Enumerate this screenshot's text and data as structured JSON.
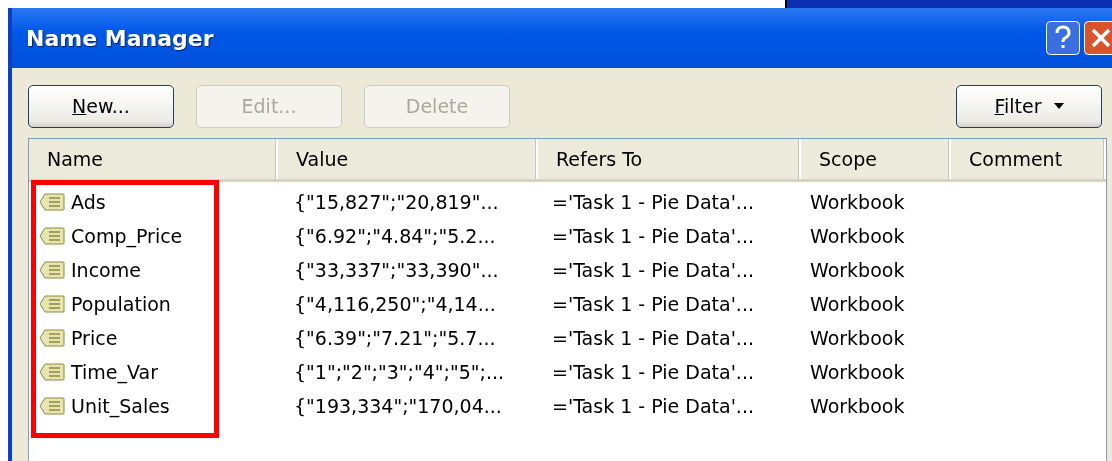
{
  "window": {
    "title": "Name Manager"
  },
  "buttons": [
    {
      "label": "New...",
      "disabled": false,
      "underline_first": true
    },
    {
      "label": "Edit...",
      "disabled": true,
      "underline_first": false
    },
    {
      "label": "Delete",
      "disabled": true,
      "underline_first": false
    }
  ],
  "filter_button": {
    "label": "Filter",
    "underline_first": true
  },
  "table": {
    "columns": [
      "Name",
      "Value",
      "Refers To",
      "Scope",
      "Comment"
    ],
    "rows": [
      {
        "name": "Ads",
        "value": "{\"15,827\";\"20,819\"...",
        "refers_to": "='Task 1 - Pie Data'...",
        "scope": "Workbook"
      },
      {
        "name": "Comp_Price",
        "value": "{\"6.92\";\"4.84\";\"5.2...",
        "refers_to": "='Task 1 - Pie Data'...",
        "scope": "Workbook"
      },
      {
        "name": "Income",
        "value": "{\"33,337\";\"33,390\"...",
        "refers_to": "='Task 1 - Pie Data'...",
        "scope": "Workbook"
      },
      {
        "name": "Population",
        "value": "{\"4,116,250\";\"4,14...",
        "refers_to": "='Task 1 - Pie Data'...",
        "scope": "Workbook"
      },
      {
        "name": "Price",
        "value": "{\"6.39\";\"7.21\";\"5.7...",
        "refers_to": "='Task 1 - Pie Data'...",
        "scope": "Workbook"
      },
      {
        "name": "Time_Var",
        "value": "{\"1\";\"2\";\"3\";\"4\";\"5\";...",
        "refers_to": "='Task 1 - Pie Data'...",
        "scope": "Workbook"
      },
      {
        "name": "Unit_Sales",
        "value": "{\"193,334\";\"170,04...",
        "refers_to": "='Task 1 - Pie Data'...",
        "scope": "Workbook"
      }
    ]
  }
}
